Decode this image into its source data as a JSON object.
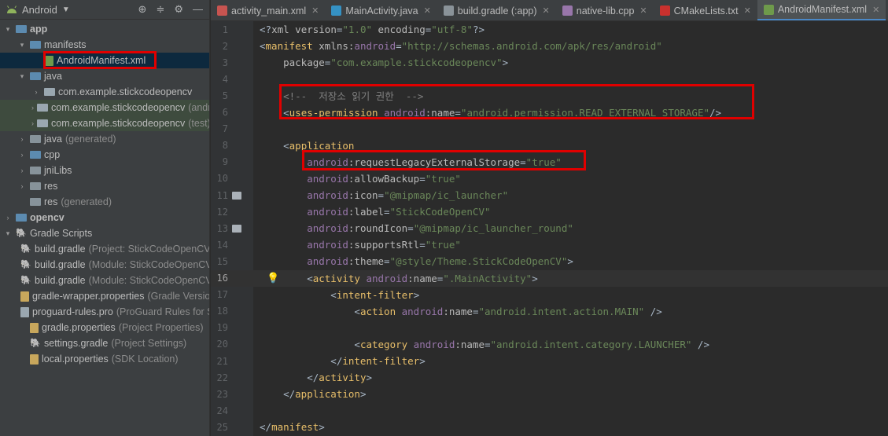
{
  "project_panel": {
    "view_selector": "Android",
    "tree": [
      {
        "label": "app",
        "note": "",
        "indent": 0,
        "arrow": "▾",
        "icon": "folder blue",
        "bold": true
      },
      {
        "label": "manifests",
        "note": "",
        "indent": 1,
        "arrow": "▾",
        "icon": "folder blue"
      },
      {
        "label": "AndroidManifest.xml",
        "note": "",
        "indent": 2,
        "arrow": "",
        "icon": "xml",
        "selected": true
      },
      {
        "label": "java",
        "note": "",
        "indent": 1,
        "arrow": "▾",
        "icon": "folder blue"
      },
      {
        "label": "com.example.stickcodeopencv",
        "note": "",
        "indent": 2,
        "arrow": "›",
        "icon": "folder pkg"
      },
      {
        "label": "com.example.stickcodeopencv",
        "note": "(androidTest)",
        "indent": 2,
        "arrow": "›",
        "icon": "folder pkg",
        "green": true
      },
      {
        "label": "com.example.stickcodeopencv",
        "note": "(test)",
        "indent": 2,
        "arrow": "›",
        "icon": "folder pkg",
        "green": true
      },
      {
        "label": "java",
        "note": "(generated)",
        "indent": 1,
        "arrow": "›",
        "icon": "folder"
      },
      {
        "label": "cpp",
        "note": "",
        "indent": 1,
        "arrow": "›",
        "icon": "folder blue"
      },
      {
        "label": "jniLibs",
        "note": "",
        "indent": 1,
        "arrow": "›",
        "icon": "folder"
      },
      {
        "label": "res",
        "note": "",
        "indent": 1,
        "arrow": "›",
        "icon": "folder"
      },
      {
        "label": "res",
        "note": "(generated)",
        "indent": 1,
        "arrow": "",
        "icon": "folder"
      },
      {
        "label": "opencv",
        "note": "",
        "indent": 0,
        "arrow": "›",
        "icon": "folder blue",
        "bold": true
      },
      {
        "label": "Gradle Scripts",
        "note": "",
        "indent": 0,
        "arrow": "▾",
        "icon": "gradle"
      },
      {
        "label": "build.gradle",
        "note": "(Project: StickCodeOpenCV)",
        "indent": 1,
        "arrow": "",
        "icon": "gradle"
      },
      {
        "label": "build.gradle",
        "note": "(Module: StickCodeOpenCV.app)",
        "indent": 1,
        "arrow": "",
        "icon": "gradle"
      },
      {
        "label": "build.gradle",
        "note": "(Module: StickCodeOpenCV.opencv)",
        "indent": 1,
        "arrow": "",
        "icon": "gradle"
      },
      {
        "label": "gradle-wrapper.properties",
        "note": "(Gradle Version)",
        "indent": 1,
        "arrow": "",
        "icon": "props"
      },
      {
        "label": "proguard-rules.pro",
        "note": "(ProGuard Rules for StickCodeOpenCV.app)",
        "indent": 1,
        "arrow": "",
        "icon": "txt"
      },
      {
        "label": "gradle.properties",
        "note": "(Project Properties)",
        "indent": 1,
        "arrow": "",
        "icon": "props"
      },
      {
        "label": "settings.gradle",
        "note": "(Project Settings)",
        "indent": 1,
        "arrow": "",
        "icon": "gradle"
      },
      {
        "label": "local.properties",
        "note": "(SDK Location)",
        "indent": 1,
        "arrow": "",
        "icon": "props"
      }
    ]
  },
  "tabs": [
    {
      "label": "activity_main.xml",
      "color": "#c75450",
      "active": false
    },
    {
      "label": "MainActivity.java",
      "color": "#3592c4",
      "active": false
    },
    {
      "label": "build.gradle (:app)",
      "color": "#8a9399",
      "active": false
    },
    {
      "label": "native-lib.cpp",
      "color": "#9876aa",
      "active": false
    },
    {
      "label": "CMakeLists.txt",
      "color": "#c9312e",
      "active": false
    },
    {
      "label": "AndroidManifest.xml",
      "color": "#6e9a4b",
      "active": true
    }
  ],
  "editor": {
    "current_line": 16,
    "lines": [
      {
        "n": "1",
        "tokens": [
          [
            "t-plain",
            "<?"
          ],
          [
            "t-attr",
            "xml version"
          ],
          [
            "t-plain",
            "="
          ],
          [
            "t-str",
            "\"1.0\""
          ],
          [
            "t-attr",
            " encoding"
          ],
          [
            "t-plain",
            "="
          ],
          [
            "t-str",
            "\"utf-8\""
          ],
          [
            "t-plain",
            "?>"
          ]
        ]
      },
      {
        "n": "2",
        "tokens": [
          [
            "t-plain",
            "<"
          ],
          [
            "t-tag",
            "manifest "
          ],
          [
            "t-attr",
            "xmlns:"
          ],
          [
            "t-ns",
            "android"
          ],
          [
            "t-plain",
            "="
          ],
          [
            "t-str",
            "\"http://schemas.android.com/apk/res/android\""
          ]
        ]
      },
      {
        "n": "3",
        "tokens": [
          [
            "t-attr",
            "    package"
          ],
          [
            "t-plain",
            "="
          ],
          [
            "t-str",
            "\"com.example.stickcodeopencv\""
          ],
          [
            "t-plain",
            ">"
          ]
        ]
      },
      {
        "n": "4",
        "tokens": []
      },
      {
        "n": "5",
        "tokens": [
          [
            "t-comment",
            "    <!--  저장소 읽기 권한  -->"
          ]
        ]
      },
      {
        "n": "6",
        "tokens": [
          [
            "t-plain",
            "    <"
          ],
          [
            "t-tag",
            "uses-permission "
          ],
          [
            "t-ns",
            "android"
          ],
          [
            "t-attr",
            ":name"
          ],
          [
            "t-plain",
            "="
          ],
          [
            "t-str",
            "\"android.permission.READ_EXTERNAL_STORAGE\""
          ],
          [
            "t-plain",
            "/>"
          ]
        ]
      },
      {
        "n": "7",
        "tokens": []
      },
      {
        "n": "8",
        "tokens": [
          [
            "t-plain",
            "    <"
          ],
          [
            "t-tag",
            "application"
          ]
        ]
      },
      {
        "n": "9",
        "tokens": [
          [
            "t-ns",
            "        android"
          ],
          [
            "t-attr",
            ":requestLegacyExternalStorage"
          ],
          [
            "t-plain",
            "="
          ],
          [
            "t-str",
            "\"true\""
          ]
        ]
      },
      {
        "n": "10",
        "tokens": [
          [
            "t-ns",
            "        android"
          ],
          [
            "t-attr",
            ":allowBackup"
          ],
          [
            "t-plain",
            "="
          ],
          [
            "t-str",
            "\"true\""
          ]
        ]
      },
      {
        "n": "11",
        "tokens": [
          [
            "t-ns",
            "        android"
          ],
          [
            "t-attr",
            ":icon"
          ],
          [
            "t-plain",
            "="
          ],
          [
            "t-str",
            "\"@mipmap/ic_launcher\""
          ]
        ],
        "gutter_icon": true
      },
      {
        "n": "12",
        "tokens": [
          [
            "t-ns",
            "        android"
          ],
          [
            "t-attr",
            ":label"
          ],
          [
            "t-plain",
            "="
          ],
          [
            "t-str",
            "\"StickCodeOpenCV\""
          ]
        ]
      },
      {
        "n": "13",
        "tokens": [
          [
            "t-ns",
            "        android"
          ],
          [
            "t-attr",
            ":roundIcon"
          ],
          [
            "t-plain",
            "="
          ],
          [
            "t-str",
            "\"@mipmap/ic_launcher_round\""
          ]
        ],
        "gutter_icon": true
      },
      {
        "n": "14",
        "tokens": [
          [
            "t-ns",
            "        android"
          ],
          [
            "t-attr",
            ":supportsRtl"
          ],
          [
            "t-plain",
            "="
          ],
          [
            "t-str",
            "\"true\""
          ]
        ]
      },
      {
        "n": "15",
        "tokens": [
          [
            "t-ns",
            "        android"
          ],
          [
            "t-attr",
            ":theme"
          ],
          [
            "t-plain",
            "="
          ],
          [
            "t-str",
            "\"@style/Theme.StickCodeOpenCV\""
          ],
          [
            "t-plain",
            ">"
          ]
        ]
      },
      {
        "n": "16",
        "tokens": [
          [
            "t-plain",
            "        <"
          ],
          [
            "t-tag",
            "activity "
          ],
          [
            "t-ns",
            "android"
          ],
          [
            "t-attr",
            ":name"
          ],
          [
            "t-plain",
            "="
          ],
          [
            "t-str",
            "\".MainActivity\""
          ],
          [
            "t-plain",
            ">"
          ]
        ],
        "bulb": true
      },
      {
        "n": "17",
        "tokens": [
          [
            "t-plain",
            "            <"
          ],
          [
            "t-tag",
            "intent-filter"
          ],
          [
            "t-plain",
            ">"
          ]
        ]
      },
      {
        "n": "18",
        "tokens": [
          [
            "t-plain",
            "                <"
          ],
          [
            "t-tag",
            "action "
          ],
          [
            "t-ns",
            "android"
          ],
          [
            "t-attr",
            ":name"
          ],
          [
            "t-plain",
            "="
          ],
          [
            "t-str",
            "\"android.intent.action.MAIN\""
          ],
          [
            "t-plain",
            " />"
          ]
        ]
      },
      {
        "n": "19",
        "tokens": []
      },
      {
        "n": "20",
        "tokens": [
          [
            "t-plain",
            "                <"
          ],
          [
            "t-tag",
            "category "
          ],
          [
            "t-ns",
            "android"
          ],
          [
            "t-attr",
            ":name"
          ],
          [
            "t-plain",
            "="
          ],
          [
            "t-str",
            "\"android.intent.category.LAUNCHER\""
          ],
          [
            "t-plain",
            " />"
          ]
        ]
      },
      {
        "n": "21",
        "tokens": [
          [
            "t-plain",
            "            </"
          ],
          [
            "t-tag",
            "intent-filter"
          ],
          [
            "t-plain",
            ">"
          ]
        ]
      },
      {
        "n": "22",
        "tokens": [
          [
            "t-plain",
            "        </"
          ],
          [
            "t-tag",
            "activity"
          ],
          [
            "t-plain",
            ">"
          ]
        ]
      },
      {
        "n": "23",
        "tokens": [
          [
            "t-plain",
            "    </"
          ],
          [
            "t-tag",
            "application"
          ],
          [
            "t-plain",
            ">"
          ]
        ]
      },
      {
        "n": "24",
        "tokens": []
      },
      {
        "n": "25",
        "tokens": [
          [
            "t-plain",
            "</"
          ],
          [
            "t-tag",
            "manifest"
          ],
          [
            "t-plain",
            ">"
          ]
        ]
      }
    ]
  }
}
